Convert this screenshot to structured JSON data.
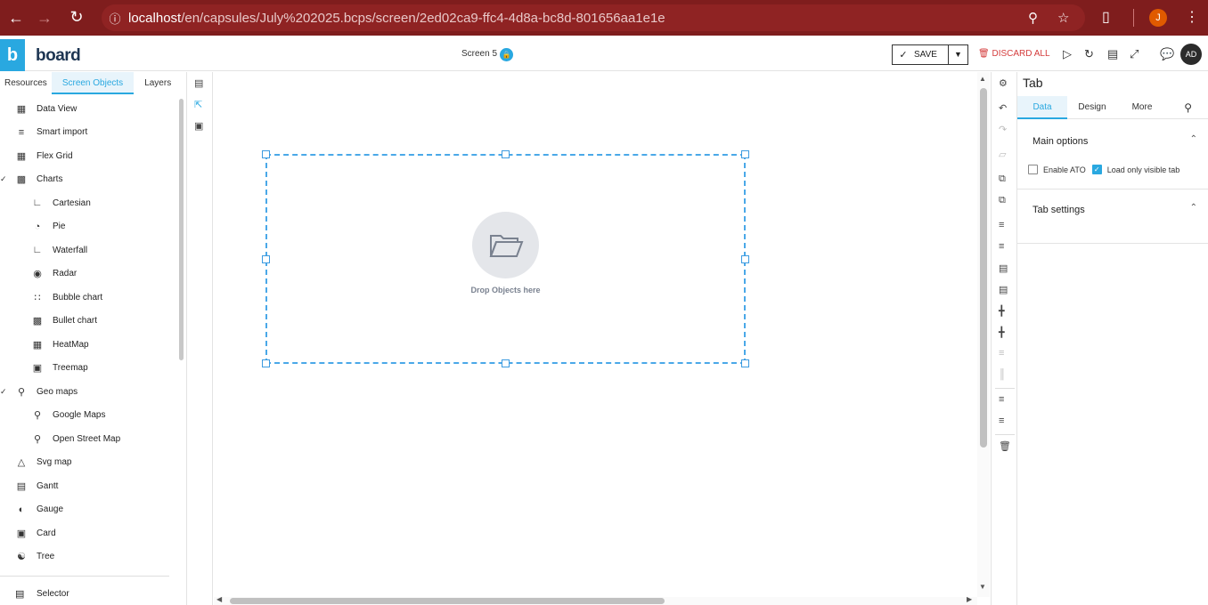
{
  "browser": {
    "url_host": "localhost",
    "url_path": "/en/capsules/July%202025.bcps/screen/2ed02ca9-ffc4-4d8a-bc8d-801656aa1e1e",
    "profile_initial": "J"
  },
  "header": {
    "logo_letter": "b",
    "logo_word": "board",
    "screen_name": "Screen 5",
    "save_label": "SAVE",
    "discard_label": "DISCARD ALL",
    "user_initials": "AD"
  },
  "left_panel": {
    "tabs": [
      "Resources",
      "Screen Objects",
      "Layers"
    ],
    "active_tab": "Screen Objects",
    "items": [
      {
        "label": "Data View",
        "icon": "table-icon"
      },
      {
        "label": "Smart import",
        "icon": "import-icon"
      },
      {
        "label": "Flex Grid",
        "icon": "grid-icon"
      },
      {
        "label": "Charts",
        "icon": "bar-chart-icon"
      },
      {
        "label": "Cartesian",
        "icon": "line-chart-icon"
      },
      {
        "label": "Pie",
        "icon": "pie-chart-icon"
      },
      {
        "label": "Waterfall",
        "icon": "waterfall-icon"
      },
      {
        "label": "Radar",
        "icon": "radar-icon"
      },
      {
        "label": "Bubble chart",
        "icon": "bubble-chart-icon"
      },
      {
        "label": "Bullet chart",
        "icon": "bullet-chart-icon"
      },
      {
        "label": "HeatMap",
        "icon": "heatmap-icon"
      },
      {
        "label": "Treemap",
        "icon": "treemap-icon"
      },
      {
        "label": "Geo maps",
        "icon": "map-pin-icon"
      },
      {
        "label": "Google Maps",
        "icon": "location-icon"
      },
      {
        "label": "Open Street Map",
        "icon": "map-marker-icon"
      },
      {
        "label": "Svg map",
        "icon": "svg-map-icon"
      },
      {
        "label": "Gantt",
        "icon": "gantt-icon"
      },
      {
        "label": "Gauge",
        "icon": "gauge-icon"
      },
      {
        "label": "Card",
        "icon": "card-icon"
      },
      {
        "label": "Tree",
        "icon": "tree-icon"
      }
    ],
    "selector_label": "Selector"
  },
  "canvas": {
    "drop_text": "Drop Objects here"
  },
  "properties": {
    "title": "Tab",
    "tabs": [
      "Data",
      "Design",
      "More"
    ],
    "active_tab": "Data",
    "main_options_title": "Main options",
    "enable_ato_label": "Enable ATO",
    "load_visible_label": "Load only visible tab",
    "tab_settings_title": "Tab settings"
  },
  "colors": {
    "accent": "#29a8e0",
    "browser_bar": "#7f1d1d",
    "discard": "#d43c3c"
  }
}
